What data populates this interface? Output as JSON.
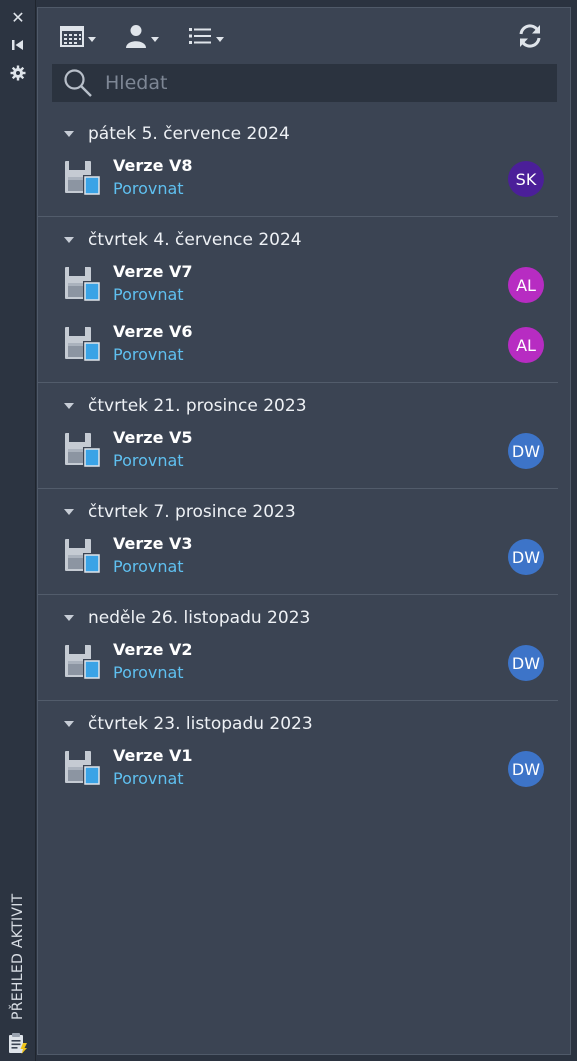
{
  "side_strip": {
    "close_icon": "close-icon",
    "collapse_icon": "collapse-left-icon",
    "settings_icon": "gear-icon",
    "title": "PŘEHLED AKTIVIT"
  },
  "toolbar": {
    "calendar_icon": "calendar-icon",
    "user_icon": "user-icon",
    "list_icon": "list-icon",
    "refresh_icon": "refresh-icon"
  },
  "search": {
    "placeholder": "Hledat"
  },
  "colors": {
    "panel_bg": "#3b4453",
    "link": "#5fc0f0",
    "avatar_SK": "#4b1f99",
    "avatar_AL": "#b72cc2",
    "avatar_DW": "#3d74c8"
  },
  "groups": [
    {
      "date": "pátek 5. července 2024",
      "versions": [
        {
          "title": "Verze V8",
          "link": "Porovnat",
          "initials": "SK"
        }
      ]
    },
    {
      "date": "čtvrtek 4. července 2024",
      "versions": [
        {
          "title": "Verze V7",
          "link": "Porovnat",
          "initials": "AL"
        },
        {
          "title": "Verze V6",
          "link": "Porovnat",
          "initials": "AL"
        }
      ]
    },
    {
      "date": "čtvrtek 21. prosince 2023",
      "versions": [
        {
          "title": "Verze V5",
          "link": "Porovnat",
          "initials": "DW"
        }
      ]
    },
    {
      "date": "čtvrtek 7. prosince 2023",
      "versions": [
        {
          "title": "Verze V3",
          "link": "Porovnat",
          "initials": "DW"
        }
      ]
    },
    {
      "date": "neděle 26. listopadu 2023",
      "versions": [
        {
          "title": "Verze V2",
          "link": "Porovnat",
          "initials": "DW"
        }
      ]
    },
    {
      "date": "čtvrtek 23. listopadu 2023",
      "versions": [
        {
          "title": "Verze V1",
          "link": "Porovnat",
          "initials": "DW"
        }
      ]
    }
  ]
}
